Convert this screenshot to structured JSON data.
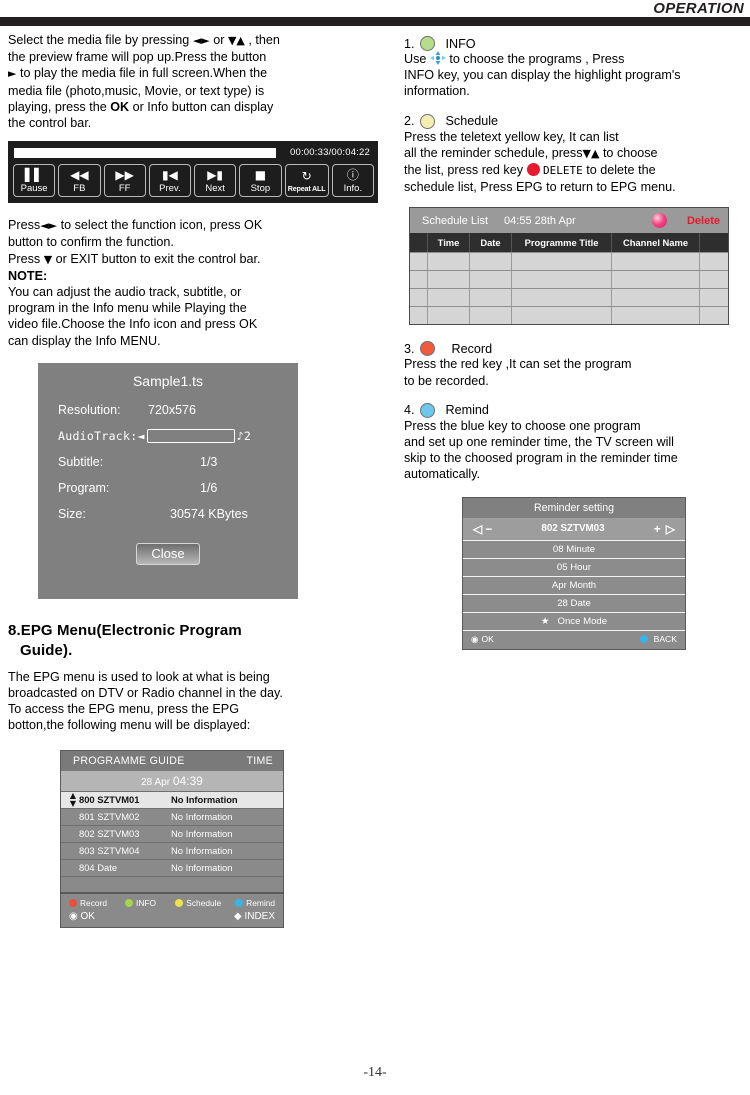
{
  "header": {
    "title": "OPERATION"
  },
  "page": {
    "number": "-14-"
  },
  "left": {
    "intro_p1": "Select the media file by pressing",
    "intro_sym1": "◄►",
    "intro_or": "or",
    "intro_sym2": "▼▲",
    "intro_p2": ", then",
    "intro_l2": "the preview frame will pop up.Press the button",
    "intro_sym3": "►",
    "intro_l3": "to play the media file in full screen.When the",
    "intro_l4": "media file (photo,music, Movie, or text type) is",
    "intro_l5a": "playing, press the",
    "intro_l5b": "OK",
    "intro_l5c": "or Info button can display",
    "intro_l6": "the control bar.",
    "controlbar": {
      "progress_time": "00:00:33/00:04:22",
      "buttons": [
        {
          "icon": "pause-icon",
          "glyph": "▐▌",
          "label": "Pause"
        },
        {
          "icon": "rewind-icon",
          "glyph": "◀◀",
          "label": "FB"
        },
        {
          "icon": "fast-forward-icon",
          "glyph": "▶▶",
          "label": "FF"
        },
        {
          "icon": "previous-icon",
          "glyph": "⏮",
          "label": "Prev."
        },
        {
          "icon": "next-icon",
          "glyph": "⏭",
          "label": "Next"
        },
        {
          "icon": "stop-icon",
          "glyph": "■",
          "label": "Stop"
        },
        {
          "icon": "repeat-icon",
          "glyph": "↻",
          "label": "Repeat ALL"
        },
        {
          "icon": "info-icon",
          "glyph": "ℹ",
          "label": "Info."
        }
      ]
    },
    "after_p1": "Press",
    "after_sym1": "◄►",
    "after_p2": "to select the function icon, press OK",
    "after_l2": "button to confirm the function.",
    "after_l3a": "Press",
    "after_sym2": "▼",
    "after_l3b": "or EXIT button to exit the control bar.",
    "note_label": "NOTE:",
    "note_l1": "You can adjust the audio track, subtitle, or",
    "note_l2": "program in the Info menu while Playing the",
    "note_l3": "video file.Choose the Info icon and press OK",
    "note_l4": "can display the Info MENU.",
    "info_panel": {
      "title": "Sample1.ts",
      "rows": [
        {
          "key": "Resolution:",
          "value": "720x576"
        },
        {
          "key": "Subtitle:",
          "value": "1/3"
        },
        {
          "key": "Program:",
          "value": "1/6"
        },
        {
          "key": "Size:",
          "value": "30574 KBytes"
        }
      ],
      "audio_key": "AudioTrack:",
      "audio_left_arrow": "◄",
      "audio_right": "♪2",
      "close_label": "Close"
    },
    "section": {
      "heading_l1": "8.EPG Menu(Electronic Program",
      "heading_l2": "Guide).",
      "body_l1": "The EPG menu is used to look at what is being",
      "body_l2": "broadcasted on DTV or Radio channel  in the day.",
      "body_l3": "To access the EPG menu, press the EPG",
      "body_l4": "botton,the following menu will be displayed:"
    },
    "epg": {
      "head_left": "PROGRAMME GUIDE",
      "head_right": "TIME",
      "date_day": "28 Apr",
      "date_time": "04:39",
      "rows": [
        {
          "channel": "800 SZTVM01",
          "info": "No Information",
          "selected": true
        },
        {
          "channel": "801 SZTVM02",
          "info": "No Information",
          "selected": false
        },
        {
          "channel": "802 SZTVM03",
          "info": "No Information",
          "selected": false
        },
        {
          "channel": "803 SZTVM04",
          "info": "No Information",
          "selected": false
        },
        {
          "channel": "804 Date",
          "info": "No Information",
          "selected": false
        }
      ],
      "keys": [
        {
          "label": "Record",
          "color": "#e8503a"
        },
        {
          "label": "INFO",
          "color": "#a8d34a"
        },
        {
          "label": "Schedule",
          "color": "#f0e04a"
        },
        {
          "label": "Remind",
          "color": "#37b5e8"
        }
      ],
      "ok_label": "OK",
      "index_label": "INDEX"
    }
  },
  "right": {
    "item1": {
      "num": "1.",
      "title": "INFO",
      "dot_color": "#b6dd8c",
      "l1a": "Use",
      "l1b": "to choose the programs , Press",
      "l2": "INFO key, you  can display the highlight  program's",
      "l3": "information."
    },
    "item2": {
      "num": "2.",
      "title": "Schedule",
      "dot_color": "#f4efb0",
      "l1": "Press  the  teletext yellow key, It can list",
      "l2a": "all the reminder schedule, press",
      "l2sym": "▼▲",
      "l2b": "to choose",
      "l3a": "the list,  press red key",
      "l3b": "DELETE",
      "l3c": "to delete the",
      "l4": "schedule list, Press EPG  to return to EPG  menu."
    },
    "schedule_list": {
      "title": "Schedule List",
      "time": "04:55  28th Apr",
      "delete_label": "Delete",
      "columns": [
        "",
        "Time",
        "Date",
        "Programme Title",
        "Channel Name",
        ""
      ],
      "rows": [
        [
          "",
          "",
          "",
          "",
          "",
          ""
        ],
        [
          "",
          "",
          "",
          "",
          "",
          ""
        ],
        [
          "",
          "",
          "",
          "",
          "",
          ""
        ],
        [
          "",
          "",
          "",
          "",
          "",
          ""
        ]
      ]
    },
    "item3": {
      "num": "3.",
      "title": "Record",
      "dot_color": "#ef5b3c",
      "l1": "Press  the  red key ,It can set the program",
      "l2": "to be recorded."
    },
    "item4": {
      "num": "4.",
      "title": "Remind",
      "dot_color": "#6ec6ea",
      "l1": "Press the blue key to choose one program",
      "l2": "and set up one reminder time, the TV screen will",
      "l3": "skip to the choosed program in the reminder time",
      "l4": "automatically."
    },
    "reminder": {
      "title": "Reminder setting",
      "channel": "802 SZTVM03",
      "minus": "−",
      "plus": "+",
      "left_arrow": "◁",
      "right_arrow": "▷",
      "items": [
        {
          "label": "08 Minute",
          "star": false
        },
        {
          "label": "05 Hour",
          "star": false
        },
        {
          "label": "Apr Month",
          "star": false
        },
        {
          "label": "28 Date",
          "star": false
        },
        {
          "label": "Once Mode",
          "star": true
        }
      ],
      "ok_label": "OK",
      "back_label": "BACK",
      "back_dot_color": "#37b5e8"
    }
  }
}
